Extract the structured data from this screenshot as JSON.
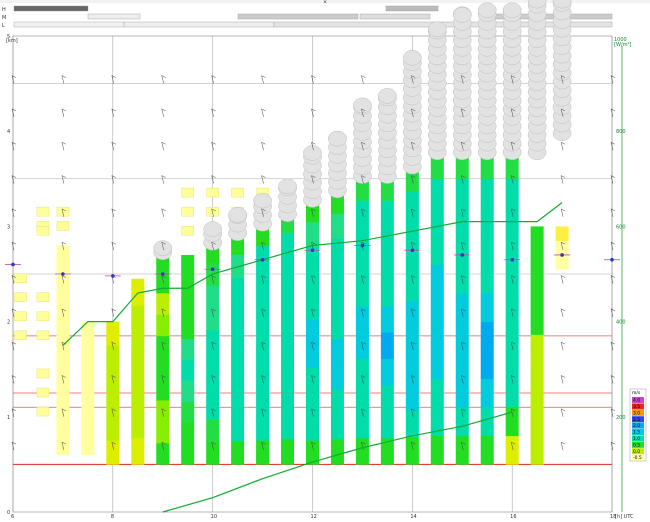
{
  "header": {
    "row_labels": [
      "H",
      "M",
      "L"
    ],
    "close_glyph": "×"
  },
  "chart_data": {
    "type": "meteogram",
    "x": {
      "ticks": [
        6,
        8,
        10,
        12,
        14,
        16,
        18
      ],
      "unit_label": "[h] UTC",
      "range": [
        6,
        18
      ]
    },
    "y_left": {
      "unit_label": "[km]",
      "ticks": [
        0,
        1,
        2,
        3,
        4,
        5
      ],
      "range": [
        0,
        5
      ]
    },
    "y_right": {
      "label_top": "1000",
      "unit_label": "[W/m²]",
      "ticks": [
        200,
        400,
        600,
        800
      ],
      "range": [
        0,
        1000
      ],
      "series_name": "solar radiation",
      "color": "#0a9a2a"
    },
    "thermal_columns": [
      {
        "t": 7.0,
        "top": 2.8,
        "base": 0.6,
        "colors": [
          "#ffffa0",
          "#ffffa0",
          "#ffffa0",
          "#ffffa0",
          "#ffffa0",
          "#ffffa0",
          "#ffffa0"
        ]
      },
      {
        "t": 7.5,
        "top": 2.0,
        "base": 0.6,
        "colors": [
          "#ffffa0",
          "#ffffa0",
          "#ffffa0",
          "#ffffa0",
          "#ffffa0"
        ]
      },
      {
        "t": 8.0,
        "top": 2.0,
        "base": 0.5,
        "colors": [
          "#ddee00",
          "#bbee00",
          "#bbee00",
          "#bbee00",
          "#bbee00",
          "#ddee00"
        ]
      },
      {
        "t": 8.5,
        "top": 2.45,
        "base": 0.5,
        "colors": [
          "#ddee00",
          "#bbee00",
          "#bbee00",
          "#bbee00",
          "#bbee00",
          "#bbee00",
          "#ddee00"
        ]
      },
      {
        "t": 9.0,
        "top": 2.75,
        "base": 0.5,
        "colors": [
          "#22dd22",
          "#88ee00",
          "#88ee00",
          "#22dd22",
          "#22dd22",
          "#22dd22",
          "#88ee00",
          "#bbee00",
          "#22dd22",
          "#22dd22"
        ]
      },
      {
        "t": 9.5,
        "top": 2.7,
        "base": 0.5,
        "colors": [
          "#22dd22",
          "#22dd22",
          "#22dd44",
          "#22dd88",
          "#00ddaa",
          "#22dd88",
          "#22dd22",
          "#22dd22",
          "#22dd22",
          "#22dd22"
        ]
      },
      {
        "t": 10.0,
        "top": 2.85,
        "base": 0.5,
        "colors": [
          "#22dd22",
          "#22dd44",
          "#00ddaa",
          "#00ddaa",
          "#00ddaa",
          "#00ddaa",
          "#22dd88",
          "#22dd88",
          "#22dd44",
          "#22dd22"
        ]
      },
      {
        "t": 10.5,
        "top": 2.95,
        "base": 0.5,
        "colors": [
          "#22dd22",
          "#00ddaa",
          "#00ddaa",
          "#00ddaa",
          "#00ddaa",
          "#00ddaa",
          "#00ddaa",
          "#00ddaa",
          "#22dd88",
          "#22dd22"
        ]
      },
      {
        "t": 11.0,
        "top": 3.05,
        "base": 0.5,
        "colors": [
          "#22dd22",
          "#00ddaa",
          "#00ddaa",
          "#00ddaa",
          "#00ddaa",
          "#00ddaa",
          "#00ddaa",
          "#00ddaa",
          "#00ddaa",
          "#22dd22"
        ]
      },
      {
        "t": 11.5,
        "top": 3.2,
        "base": 0.5,
        "colors": [
          "#22dd22",
          "#00ddaa",
          "#00ddaa",
          "#00ddaa",
          "#00ddaa",
          "#00ddaa",
          "#00ddaa",
          "#00ddaa",
          "#00ddaa",
          "#22dd44"
        ]
      },
      {
        "t": 12.0,
        "top": 3.3,
        "base": 0.5,
        "colors": [
          "#22dd22",
          "#00ddaa",
          "#00ddaa",
          "#00ddaa",
          "#00ccdd",
          "#00ccdd",
          "#00ddaa",
          "#00ddaa",
          "#00ddaa",
          "#22dd88",
          "#22dd22"
        ]
      },
      {
        "t": 12.5,
        "top": 3.4,
        "base": 0.5,
        "colors": [
          "#22dd22",
          "#00ddaa",
          "#00ddaa",
          "#00ccdd",
          "#00ccdd",
          "#00ddaa",
          "#00ddaa",
          "#00ddaa",
          "#00ddaa",
          "#22dd88",
          "#22dd22"
        ]
      },
      {
        "t": 13.0,
        "top": 3.55,
        "base": 0.5,
        "colors": [
          "#22dd22",
          "#00ddaa",
          "#00ddaa",
          "#00ddaa",
          "#00ccdd",
          "#00ccdd",
          "#00ddaa",
          "#00ddaa",
          "#00ddaa",
          "#00ddaa",
          "#22dd44"
        ]
      },
      {
        "t": 13.5,
        "top": 3.55,
        "base": 0.5,
        "colors": [
          "#22dd22",
          "#00ddaa",
          "#00ddaa",
          "#00ccdd",
          "#00aaee",
          "#00ccdd",
          "#00ddaa",
          "#00ddaa",
          "#00ddaa",
          "#00ddaa",
          "#22dd44"
        ]
      },
      {
        "t": 14.0,
        "top": 3.65,
        "base": 0.5,
        "colors": [
          "#22dd22",
          "#00ddaa",
          "#00ccdd",
          "#00ccdd",
          "#00ccdd",
          "#00ccdd",
          "#00ddaa",
          "#00ddaa",
          "#00ddaa",
          "#00ddaa",
          "#22dd44"
        ]
      },
      {
        "t": 14.5,
        "top": 3.8,
        "base": 0.5,
        "colors": [
          "#22dd22",
          "#00ddaa",
          "#00ddaa",
          "#00ccdd",
          "#00ccdd",
          "#00ccdd",
          "#00ccdd",
          "#00ddaa",
          "#00ddaa",
          "#00ddaa",
          "#22dd44"
        ]
      },
      {
        "t": 15.0,
        "top": 3.8,
        "base": 0.5,
        "colors": [
          "#22dd22",
          "#00ddaa",
          "#00ccdd",
          "#00ccdd",
          "#00ccdd",
          "#00ccdd",
          "#00ddaa",
          "#00ddaa",
          "#00ddaa",
          "#00ddaa",
          "#22dd44"
        ]
      },
      {
        "t": 15.5,
        "top": 3.8,
        "base": 0.5,
        "colors": [
          "#22dd22",
          "#00ddaa",
          "#00ccdd",
          "#00aaee",
          "#00aaee",
          "#00ccdd",
          "#00ddaa",
          "#00ddaa",
          "#00ddaa",
          "#00ddaa",
          "#22dd44"
        ]
      },
      {
        "t": 16.0,
        "top": 3.8,
        "base": 0.5,
        "colors": [
          "#ddee00",
          "#22dd22",
          "#00ddaa",
          "#00ddaa",
          "#00ddaa",
          "#00ddaa",
          "#00ddaa",
          "#00ddaa",
          "#00ddaa",
          "#00ddaa",
          "#22dd44"
        ]
      },
      {
        "t": 16.5,
        "top": 3.0,
        "base": 0.5,
        "colors": [
          "#bbee00",
          "#bbee00",
          "#bbee00",
          "#bbee00",
          "#bbee00",
          "#bbee00",
          "#22dd22",
          "#22dd22",
          "#22dd22",
          "#22dd22",
          "#22dd22"
        ]
      },
      {
        "t": 17.0,
        "top": 3.0,
        "base": 2.55,
        "colors": [
          "#ffffa0",
          "#ffffa0",
          "#ffee44"
        ]
      }
    ],
    "cloud_stacks": [
      {
        "t": 9.0,
        "base": 2.65,
        "top": 2.85
      },
      {
        "t": 10.0,
        "base": 2.75,
        "top": 3.05
      },
      {
        "t": 10.5,
        "base": 2.85,
        "top": 3.2
      },
      {
        "t": 11.0,
        "base": 2.95,
        "top": 3.35
      },
      {
        "t": 11.5,
        "base": 3.05,
        "top": 3.5
      },
      {
        "t": 12.0,
        "base": 3.2,
        "top": 3.85
      },
      {
        "t": 12.5,
        "base": 3.3,
        "top": 4.0
      },
      {
        "t": 13.0,
        "base": 3.45,
        "top": 4.35
      },
      {
        "t": 13.5,
        "base": 3.45,
        "top": 4.45
      },
      {
        "t": 14.0,
        "base": 3.55,
        "top": 4.85
      },
      {
        "t": 14.5,
        "base": 3.7,
        "top": 5.15
      },
      {
        "t": 15.0,
        "base": 3.7,
        "top": 5.3
      },
      {
        "t": 15.5,
        "base": 3.7,
        "top": 5.35
      },
      {
        "t": 16.0,
        "base": 3.7,
        "top": 5.35
      },
      {
        "t": 16.5,
        "base": 3.7,
        "top": 5.45
      },
      {
        "t": 17.0,
        "base": 3.9,
        "top": 5.45
      }
    ],
    "stable_boxes": [
      {
        "t": 6.6,
        "z": [
          3.15,
          3.0,
          2.95
        ]
      },
      {
        "t": 7.0,
        "z": [
          3.15,
          3.0
        ]
      },
      {
        "t": 6.15,
        "z": [
          2.45,
          2.25,
          2.05,
          1.85
        ]
      },
      {
        "t": 6.6,
        "z": [
          2.25,
          2.05,
          1.85
        ]
      },
      {
        "t": 6.6,
        "z": [
          1.45,
          1.25,
          1.05
        ]
      },
      {
        "t": 9.5,
        "z": [
          3.35,
          3.15,
          2.95
        ]
      },
      {
        "t": 10.0,
        "z": [
          3.35,
          3.15
        ]
      },
      {
        "t": 10.5,
        "z": [
          3.35,
          3.15
        ]
      },
      {
        "t": 11.0,
        "z": [
          3.35,
          3.15
        ]
      }
    ],
    "lines": {
      "red_horizontal_km": [
        0.5,
        1.1,
        1.25,
        1.85
      ],
      "grey_horizontal_km": [
        2.5,
        3.5,
        4.5
      ],
      "blue_markers": [
        {
          "t": 6.0,
          "z": 2.6
        },
        {
          "t": 7.0,
          "z": 2.5
        },
        {
          "t": 8.0,
          "z": 2.48
        },
        {
          "t": 9.0,
          "z": 2.5
        },
        {
          "t": 10.0,
          "z": 2.55
        },
        {
          "t": 11.0,
          "z": 2.65
        },
        {
          "t": 12.0,
          "z": 2.75
        },
        {
          "t": 13.0,
          "z": 2.8
        },
        {
          "t": 14.0,
          "z": 2.75
        },
        {
          "t": 15.0,
          "z": 2.7
        },
        {
          "t": 16.0,
          "z": 2.65
        },
        {
          "t": 17.0,
          "z": 2.7
        },
        {
          "t": 18.0,
          "z": 2.65
        }
      ],
      "cloudbase_green": [
        {
          "t": 7.0,
          "z": 1.75
        },
        {
          "t": 7.5,
          "z": 2.0
        },
        {
          "t": 8.0,
          "z": 2.0
        },
        {
          "t": 8.5,
          "z": 2.3
        },
        {
          "t": 9.0,
          "z": 2.35
        },
        {
          "t": 9.5,
          "z": 2.35
        },
        {
          "t": 10.0,
          "z": 2.5
        },
        {
          "t": 11.0,
          "z": 2.65
        },
        {
          "t": 12.0,
          "z": 2.8
        },
        {
          "t": 13.0,
          "z": 2.85
        },
        {
          "t": 14.0,
          "z": 2.95
        },
        {
          "t": 15.0,
          "z": 3.05
        },
        {
          "t": 16.0,
          "z": 3.05
        },
        {
          "t": 16.5,
          "z": 3.05
        },
        {
          "t": 17.0,
          "z": 3.25
        }
      ],
      "radiation_green_wm2": [
        {
          "t": 9.0,
          "v": 0
        },
        {
          "t": 10.0,
          "v": 30
        },
        {
          "t": 11.0,
          "v": 70
        },
        {
          "t": 12.0,
          "v": 105
        },
        {
          "t": 13.0,
          "v": 135
        },
        {
          "t": 14.0,
          "v": 160
        },
        {
          "t": 15.0,
          "v": 180
        },
        {
          "t": 16.0,
          "v": 210
        }
      ]
    },
    "legend": {
      "title": "m/s",
      "placement": "bottom-right",
      "entries": [
        {
          "label": "4.0",
          "color": "#cc44cc"
        },
        {
          "label": "3.5",
          "color": "#ee2222"
        },
        {
          "label": "3.0",
          "color": "#ee9900"
        },
        {
          "label": "2.5",
          "color": "#3344ee"
        },
        {
          "label": "2.0",
          "color": "#00aaee"
        },
        {
          "label": "1.5",
          "color": "#00ccdd"
        },
        {
          "label": "1.0",
          "color": "#00ddaa"
        },
        {
          "label": "0.5",
          "color": "#22dd22"
        },
        {
          "label": "0.0",
          "color": "#bbee00"
        },
        {
          "label": "-0.5",
          "color": "#ffffa0"
        }
      ]
    }
  }
}
